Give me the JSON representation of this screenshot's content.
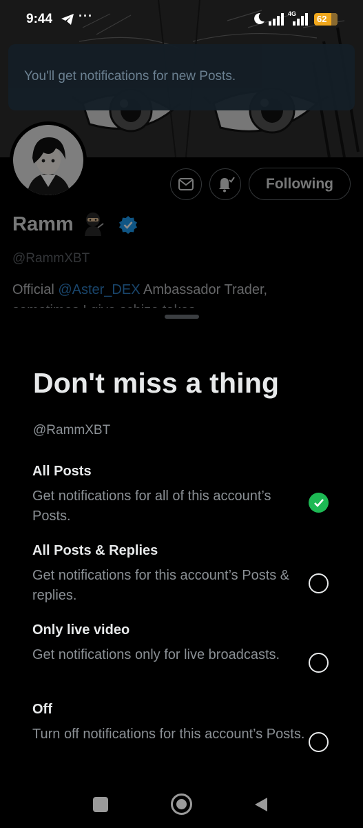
{
  "status_bar": {
    "time": "9:44",
    "dots": "···",
    "network": "4G",
    "battery": "62",
    "icons": [
      "telegram-icon",
      "moon-icon",
      "signal-icon",
      "signal-icon",
      "battery-icon"
    ]
  },
  "toast": {
    "text": "You'll get notifications for new Posts."
  },
  "profile": {
    "name": "Ramm",
    "name_emoji": "ninja-emoji",
    "handle": "@RammXBT",
    "bio_prefix": "Official ",
    "bio_mention": "@Aster_DEX",
    "bio_suffix": " Ambassador  Trader,",
    "bio_line2": "sometimes I give schizo takes",
    "following_label": "Following",
    "verified_color": "#1d9bf0"
  },
  "sheet": {
    "title": "Don't miss a thing",
    "handle": "@RammXBT",
    "options": [
      {
        "title": "All Posts",
        "desc": "Get notifications for all of this account’s Posts.",
        "selected": true
      },
      {
        "title": "All Posts & Replies",
        "desc": "Get notifications for this account’s Posts & replies.",
        "selected": false
      },
      {
        "title": "Only live video",
        "desc": "Get notifications only for live broadcasts.",
        "selected": false
      },
      {
        "title": "Off",
        "desc": "Turn off notifications for this account’s Posts.",
        "selected": false
      }
    ],
    "accent": "#1db954"
  },
  "nav": {
    "icons": [
      "recents-square-icon",
      "home-circle-icon",
      "back-triangle-icon"
    ]
  }
}
